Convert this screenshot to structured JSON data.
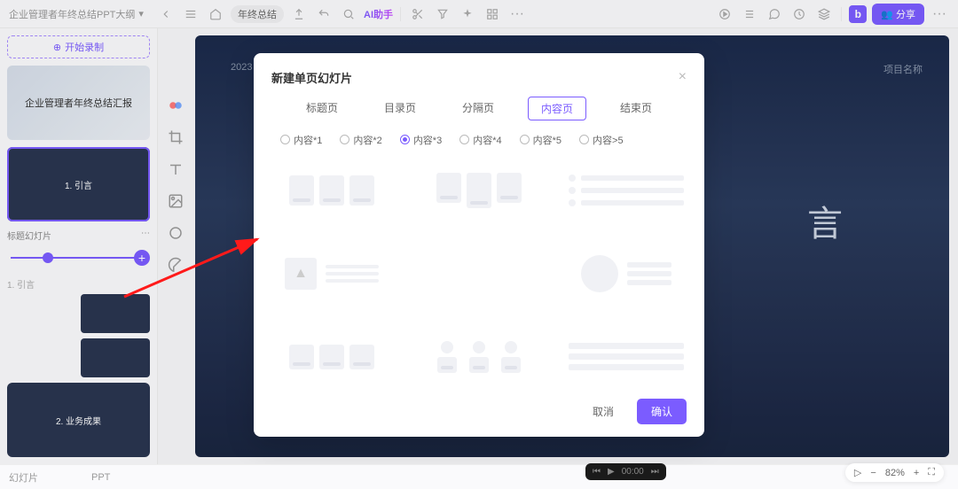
{
  "header": {
    "doc_title": "企业管理者年终总结PPT大纲",
    "tag": "年终总结",
    "ai_label": "AI助手",
    "share_label": "分享"
  },
  "sidebar": {
    "record_btn": "开始录制",
    "thumbs": [
      {
        "title": "企业管理者年终总结汇报"
      },
      {
        "title": "1. 引言"
      },
      {
        "title": "2. 业务成果"
      }
    ],
    "title_label": "标题幻灯片",
    "caption": "1. 引言",
    "tabs": {
      "left": "幻灯片",
      "right": "PPT"
    }
  },
  "canvas": {
    "year": "2023",
    "corner_label": "项目名称",
    "big_char": "言"
  },
  "modal": {
    "title": "新建单页幻灯片",
    "tabs": [
      "标题页",
      "目录页",
      "分隔页",
      "内容页",
      "结束页"
    ],
    "active_tab": 3,
    "radios": [
      "内容*1",
      "内容*2",
      "内容*3",
      "内容*4",
      "内容*5",
      "内容>5"
    ],
    "active_radio": 2,
    "cancel": "取消",
    "confirm": "确认"
  },
  "bottom": {
    "zoom": "82%"
  },
  "play": {
    "time": "00:00"
  }
}
